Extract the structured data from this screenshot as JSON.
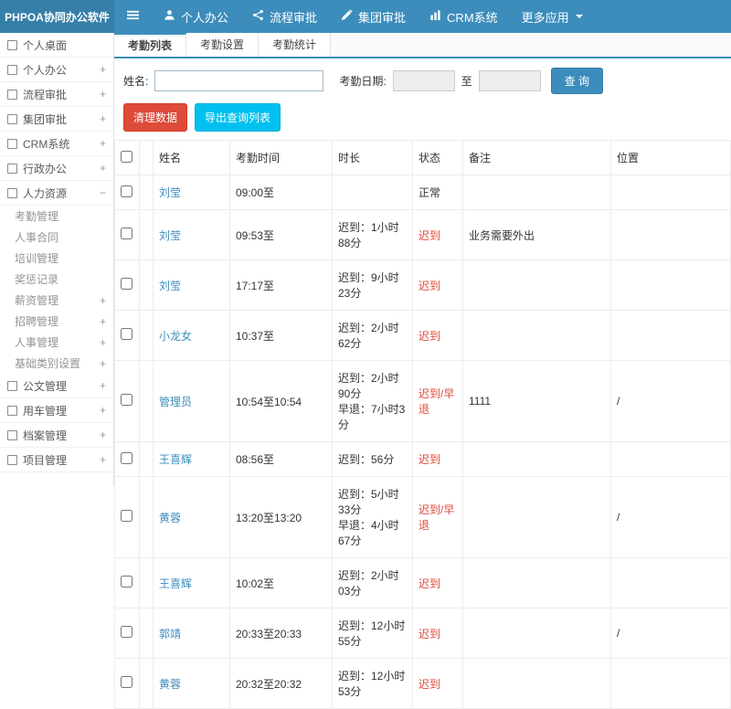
{
  "app": {
    "title": "PHPOA协同办公软件"
  },
  "topnav": {
    "items": [
      {
        "label": "个人办公"
      },
      {
        "label": "流程审批"
      },
      {
        "label": "集团审批"
      },
      {
        "label": "CRM系统"
      },
      {
        "label": "更多应用"
      }
    ]
  },
  "sidebar": {
    "items": [
      {
        "label": "个人桌面",
        "toggle": ""
      },
      {
        "label": "个人办公",
        "toggle": "+"
      },
      {
        "label": "流程审批",
        "toggle": "+"
      },
      {
        "label": "集团审批",
        "toggle": "+"
      },
      {
        "label": "CRM系统",
        "toggle": "+"
      },
      {
        "label": "行政办公",
        "toggle": "+"
      },
      {
        "label": "人力资源",
        "toggle": "−"
      },
      {
        "label": "公文管理",
        "toggle": "+"
      },
      {
        "label": "用车管理",
        "toggle": "+"
      },
      {
        "label": "档案管理",
        "toggle": "+"
      },
      {
        "label": "项目管理",
        "toggle": "+"
      }
    ],
    "hr_sub": [
      {
        "label": "考勤管理",
        "toggle": ""
      },
      {
        "label": "人事合同",
        "toggle": ""
      },
      {
        "label": "培训管理",
        "toggle": ""
      },
      {
        "label": "奖惩记录",
        "toggle": ""
      },
      {
        "label": "薪资管理",
        "toggle": "+"
      },
      {
        "label": "招聘管理",
        "toggle": "+"
      },
      {
        "label": "人事管理",
        "toggle": "+"
      },
      {
        "label": "基础类别设置",
        "toggle": "+"
      }
    ]
  },
  "tabs": [
    {
      "label": "考勤列表"
    },
    {
      "label": "考勤设置"
    },
    {
      "label": "考勤统计"
    }
  ],
  "filters": {
    "name_label": "姓名:",
    "name_value": "",
    "date_label": "考勤日期:",
    "to_label": "至",
    "search_button": "查 询"
  },
  "actions": {
    "clean_button": "清理数据",
    "export_button": "导出查询列表"
  },
  "table": {
    "headers": {
      "name": "姓名",
      "time": "考勤时间",
      "duration": "时长",
      "status": "状态",
      "note": "备注",
      "location": "位置"
    },
    "rows": [
      {
        "name": "刘莹",
        "time": "09:00至",
        "duration": "",
        "status": "正常",
        "note": "",
        "location": ""
      },
      {
        "name": "刘莹",
        "time": "09:53至",
        "duration": "迟到：1小时88分",
        "status": "迟到",
        "note": "业务需要外出",
        "location": ""
      },
      {
        "name": "刘莹",
        "time": "17:17至",
        "duration": "迟到：9小时23分",
        "status": "迟到",
        "note": "",
        "location": ""
      },
      {
        "name": "小龙女",
        "time": "10:37至",
        "duration": "迟到：2小时62分",
        "status": "迟到",
        "note": "",
        "location": ""
      },
      {
        "name": "管理员",
        "time": "10:54至10:54",
        "duration": "迟到：2小时90分\n早退：7小时3分",
        "status": "迟到/早退",
        "note": "1111",
        "location": "/"
      },
      {
        "name": "王喜辉",
        "time": "08:56至",
        "duration": "迟到：56分",
        "status": "迟到",
        "note": "",
        "location": ""
      },
      {
        "name": "黄蓉",
        "time": "13:20至13:20",
        "duration": "迟到：5小时33分\n早退：4小时67分",
        "status": "迟到/早退",
        "note": "",
        "location": "/"
      },
      {
        "name": "王喜辉",
        "time": "10:02至",
        "duration": "迟到：2小时03分",
        "status": "迟到",
        "note": "",
        "location": ""
      },
      {
        "name": "郭靖",
        "time": "20:33至20:33",
        "duration": "迟到：12小时55分",
        "status": "迟到",
        "note": "",
        "location": "/"
      },
      {
        "name": "黄蓉",
        "time": "20:32至20:32",
        "duration": "迟到：12小时53分",
        "status": "迟到",
        "note": "",
        "location": ""
      }
    ]
  },
  "colors": {
    "navbar": "#3c8dbc",
    "logo_bg": "#367fa9",
    "danger": "#dd4b39",
    "info": "#00c0ef"
  }
}
